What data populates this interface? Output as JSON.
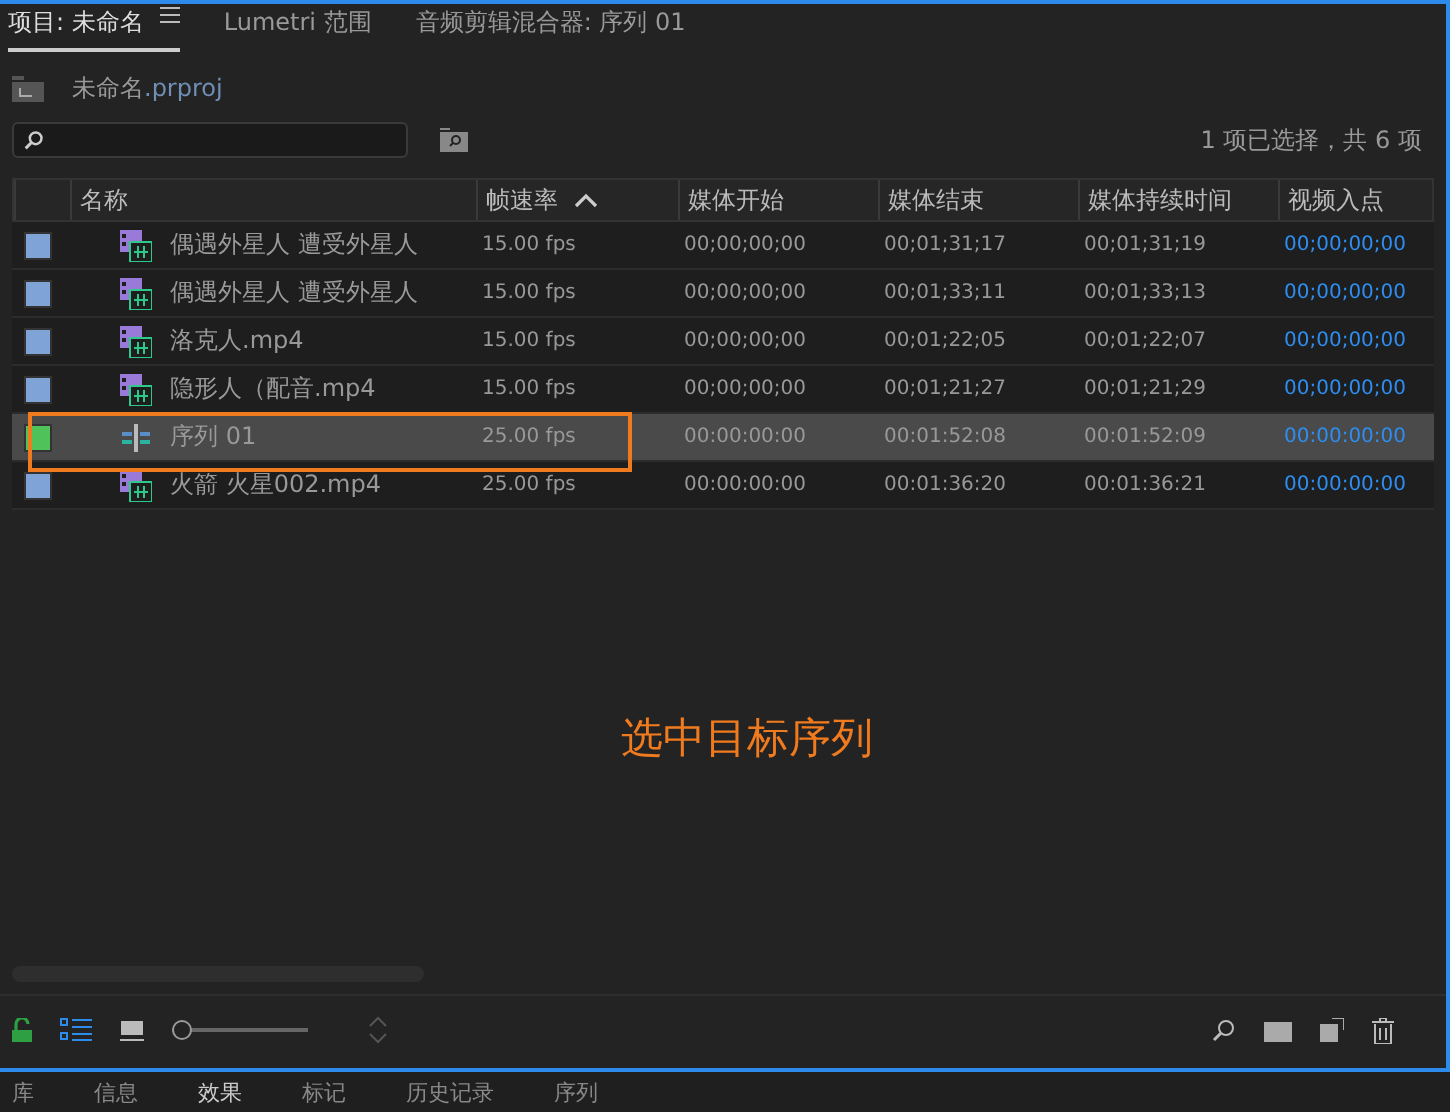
{
  "tabs": [
    {
      "label": "项目: 未命名",
      "selected": true
    },
    {
      "label": "Lumetri 范围",
      "selected": false
    },
    {
      "label": "音频剪辑混合器: 序列 01",
      "selected": false
    }
  ],
  "project": {
    "name": "未命名",
    "ext": ".prproj"
  },
  "selection_status": "1 项已选择，共 6 项",
  "table": {
    "columns": [
      "名称",
      "帧速率",
      "媒体开始",
      "媒体结束",
      "媒体持续时间",
      "视频入点"
    ],
    "rows": [
      {
        "kind": "clip",
        "color": "#7fa3d6",
        "selected": false,
        "cells": [
          "偶遇外星人 遭受外星人",
          "15.00 fps",
          "00;00;00;00",
          "00;01;31;17",
          "00;01;31;19",
          "00;00;00;00"
        ]
      },
      {
        "kind": "clip",
        "color": "#7fa3d6",
        "selected": false,
        "cells": [
          "偶遇外星人 遭受外星人",
          "15.00 fps",
          "00;00;00;00",
          "00;01;33;11",
          "00;01;33;13",
          "00;00;00;00"
        ]
      },
      {
        "kind": "clip",
        "color": "#7fa3d6",
        "selected": false,
        "cells": [
          "洛克人.mp4",
          "15.00 fps",
          "00;00;00;00",
          "00;01;22;05",
          "00;01;22;07",
          "00;00;00;00"
        ]
      },
      {
        "kind": "clip",
        "color": "#7fa3d6",
        "selected": false,
        "cells": [
          "隐形人（配音.mp4",
          "15.00 fps",
          "00;00;00;00",
          "00;01;21;27",
          "00;01;21;29",
          "00;00;00;00"
        ]
      },
      {
        "kind": "sequence",
        "color": "#4fc25a",
        "selected": true,
        "cells": [
          "序列 01",
          "25.00 fps",
          "00:00:00:00",
          "00:01:52:08",
          "00:01:52:09",
          "00:00:00:00"
        ]
      },
      {
        "kind": "clip",
        "color": "#7fa3d6",
        "selected": false,
        "cells": [
          "火箭 火星002.mp4",
          "25.00 fps",
          "00:00:00:00",
          "00:01:36:20",
          "00:01:36:21",
          "00:00:00:00"
        ]
      }
    ]
  },
  "annotation": "选中目标序列",
  "toolbar": {
    "zoom": {
      "level": 0.0
    }
  },
  "bottom_tabs": [
    {
      "label": "库",
      "selected": false
    },
    {
      "label": "信息",
      "selected": false
    },
    {
      "label": "效果",
      "selected": true
    },
    {
      "label": "标记",
      "selected": false
    },
    {
      "label": "历史记录",
      "selected": false
    },
    {
      "label": "序列",
      "selected": false
    }
  ]
}
